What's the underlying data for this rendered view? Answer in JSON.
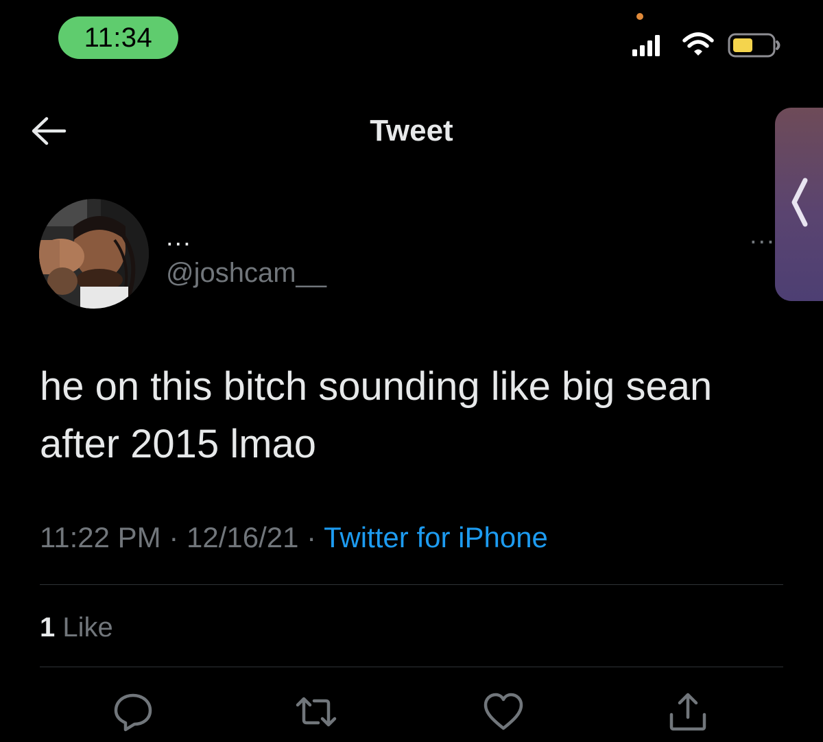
{
  "status_bar": {
    "time": "11:34",
    "icons": [
      "cellular-signal-icon",
      "wifi-icon",
      "battery-icon"
    ],
    "colors": {
      "time_pill": "#5fcc6e",
      "battery_fill": "#f4d44d",
      "privacy_dot": "#e08a3a"
    }
  },
  "header": {
    "title": "Tweet",
    "back_icon": "back-arrow-icon"
  },
  "tweet": {
    "author": {
      "display_name": "...",
      "handle": "@joshcam__"
    },
    "more_menu": "...",
    "text": "he on this bitch sounding like big sean after 2015 lmao",
    "time": "11:22 PM",
    "separator": "·",
    "date": "12/16/21",
    "source": "Twitter for iPhone",
    "likes_count": "1",
    "likes_label": "Like"
  },
  "actions": [
    {
      "name": "reply",
      "icon": "reply-icon"
    },
    {
      "name": "retweet",
      "icon": "retweet-icon"
    },
    {
      "name": "like",
      "icon": "heart-icon"
    },
    {
      "name": "share",
      "icon": "share-icon"
    }
  ],
  "colors": {
    "background": "#000000",
    "text_primary": "#e7e9ea",
    "text_secondary": "#71767b",
    "link": "#1d9bf0",
    "divider": "#2f3336",
    "side_panel": "#5a4470"
  }
}
